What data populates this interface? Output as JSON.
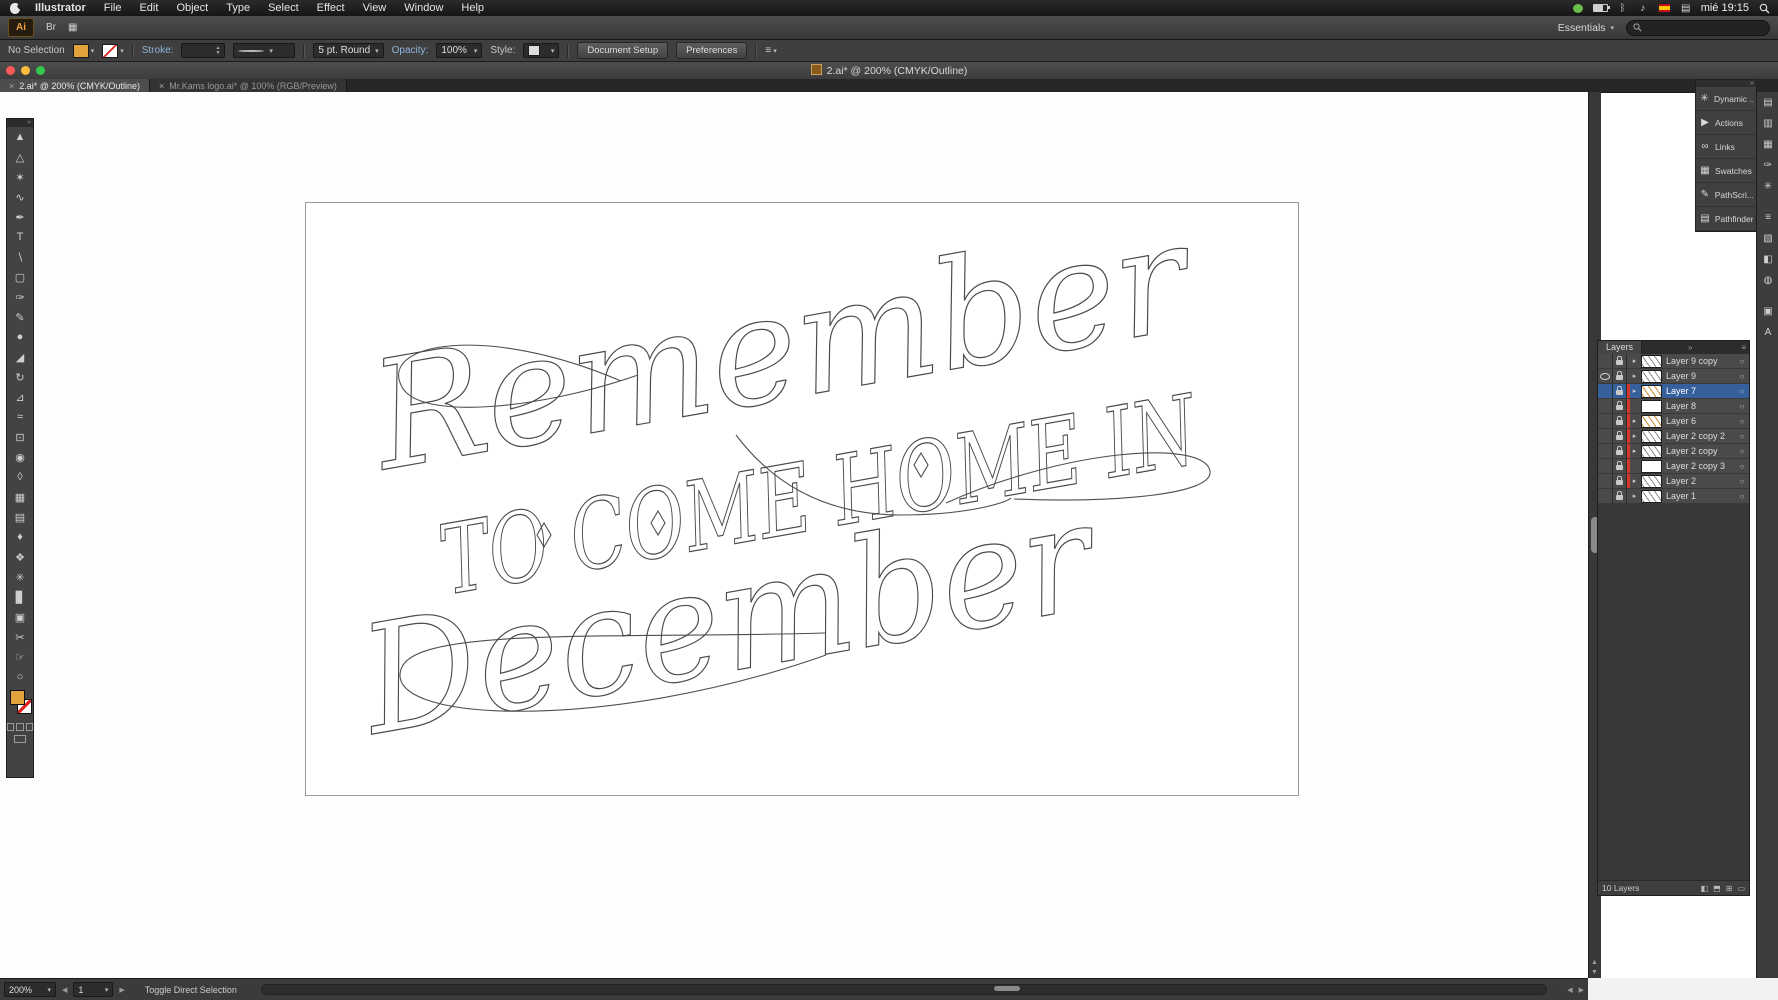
{
  "ui_colors": {
    "selection_blue": "#35609c",
    "fill_orange": "#e2a33d",
    "layer_color_red": "#d9372a",
    "artboard_outline": "#9a9a9a",
    "ui_dark": "#3f3f3f"
  },
  "icons": {
    "close": "×",
    "caret": "▾",
    "tri_right": "▸",
    "target_circle": "○",
    "collapse": "»",
    "panel_menu": "≡",
    "arrow_left": "◀",
    "arrow_right": "▶",
    "arrow_up": "▲",
    "arrow_down": "▼"
  },
  "menubar": {
    "app_name": "Illustrator",
    "menus": [
      "File",
      "Edit",
      "Object",
      "Type",
      "Select",
      "Effect",
      "View",
      "Window",
      "Help"
    ],
    "status_icons": [
      {
        "name": "green-app-icon",
        "kind": "green",
        "glyph": ""
      },
      {
        "name": "battery-icon",
        "kind": "battery",
        "glyph": ""
      },
      {
        "name": "bluetooth-icon",
        "kind": "glyph",
        "glyph": "ᛒ"
      },
      {
        "name": "volume-icon",
        "kind": "glyph",
        "glyph": "♪"
      },
      {
        "name": "keyboard-layout-flag-icon",
        "kind": "flag",
        "glyph": ""
      },
      {
        "name": "display-icon",
        "kind": "glyph",
        "glyph": "▤"
      }
    ],
    "clock": "mié 19:15"
  },
  "appbar": {
    "logo": "Ai",
    "icons": [
      {
        "name": "launch-bridge-icon",
        "glyph": "Br"
      },
      {
        "name": "arrange-documents-icon",
        "glyph": "▦"
      }
    ],
    "workspace": "Essentials",
    "search_value": ""
  },
  "controlbar": {
    "no_selection": "No Selection",
    "stroke_label": "Stroke:",
    "stroke_value": "",
    "brush_name": "5 pt. Round",
    "opacity_label": "Opacity:",
    "opacity_value": "100%",
    "style_label": "Style:",
    "buttons": {
      "document_setup": "Document Setup",
      "preferences": "Preferences"
    }
  },
  "window": {
    "title": "2.ai* @ 200% (CMYK/Outline)"
  },
  "tabs": [
    {
      "label": "2.ai* @ 200% (CMYK/Outline)",
      "active": true
    },
    {
      "label": "Mr.Kams logo.ai* @ 100% (RGB/Preview)",
      "active": false
    }
  ],
  "artwork": {
    "line1": "Remember",
    "line2": "TO COME HOME IN",
    "line3": "December"
  },
  "tools": [
    {
      "name": "selection-tool-icon",
      "glyph": "▲"
    },
    {
      "name": "direct-selection-tool-icon",
      "glyph": "△"
    },
    {
      "name": "magic-wand-tool-icon",
      "glyph": "✶"
    },
    {
      "name": "lasso-tool-icon",
      "glyph": "∿"
    },
    {
      "name": "pen-tool-icon",
      "glyph": "✒"
    },
    {
      "name": "type-tool-icon",
      "glyph": "T"
    },
    {
      "name": "line-segment-tool-icon",
      "glyph": "∖"
    },
    {
      "name": "rectangle-tool-icon",
      "glyph": "▢"
    },
    {
      "name": "paintbrush-tool-icon",
      "glyph": "✑"
    },
    {
      "name": "pencil-tool-icon",
      "glyph": "✎"
    },
    {
      "name": "blob-brush-tool-icon",
      "glyph": "●"
    },
    {
      "name": "eraser-tool-icon",
      "glyph": "◢"
    },
    {
      "name": "rotate-tool-icon",
      "glyph": "↻"
    },
    {
      "name": "scale-tool-icon",
      "glyph": "⊿"
    },
    {
      "name": "width-tool-icon",
      "glyph": "≈"
    },
    {
      "name": "free-transform-tool-icon",
      "glyph": "⊡"
    },
    {
      "name": "shape-builder-tool-icon",
      "glyph": "◉"
    },
    {
      "name": "perspective-grid-tool-icon",
      "glyph": "◊"
    },
    {
      "name": "mesh-tool-icon",
      "glyph": "▦"
    },
    {
      "name": "gradient-tool-icon",
      "glyph": "▤"
    },
    {
      "name": "eyedropper-tool-icon",
      "glyph": "♦"
    },
    {
      "name": "blend-tool-icon",
      "glyph": "❖"
    },
    {
      "name": "symbol-sprayer-tool-icon",
      "glyph": "✳"
    },
    {
      "name": "column-graph-tool-icon",
      "glyph": "▊"
    },
    {
      "name": "artboard-tool-icon",
      "glyph": "▣"
    },
    {
      "name": "slice-tool-icon",
      "glyph": "✂"
    },
    {
      "name": "hand-tool-icon",
      "glyph": "☞"
    },
    {
      "name": "zoom-tool-icon",
      "glyph": "○"
    }
  ],
  "dock_panels": [
    {
      "name": "dock-panel-dynamic",
      "glyph": "✳",
      "label": "Dynamic ..."
    },
    {
      "name": "dock-panel-actions",
      "glyph": "▶",
      "label": "Actions"
    },
    {
      "name": "dock-panel-links",
      "glyph": "∞",
      "label": "Links"
    },
    {
      "name": "dock-panel-swatches",
      "glyph": "▦",
      "label": "Swatches"
    },
    {
      "name": "dock-panel-pathscribe",
      "glyph": "✎",
      "label": "PathScri..."
    },
    {
      "name": "dock-panel-pathfinder",
      "glyph": "▤",
      "label": "Pathfinder"
    }
  ],
  "right_strip": [
    {
      "name": "color-panel-icon",
      "glyph": "▤",
      "gap": false
    },
    {
      "name": "color-guide-panel-icon",
      "glyph": "▥",
      "gap": false
    },
    {
      "name": "swatches-panel-icon",
      "glyph": "▦",
      "gap": false
    },
    {
      "name": "brushes-panel-icon",
      "glyph": "✑",
      "gap": false
    },
    {
      "name": "symbols-panel-icon",
      "glyph": "✳",
      "gap": false
    },
    {
      "name": "stroke-panel-icon",
      "glyph": "≡",
      "gap": true
    },
    {
      "name": "gradient-panel-icon",
      "glyph": "▧",
      "gap": false
    },
    {
      "name": "transparency-panel-icon",
      "glyph": "◧",
      "gap": false
    },
    {
      "name": "appearance-panel-icon",
      "glyph": "◍",
      "gap": false
    },
    {
      "name": "graphic-styles-panel-icon",
      "glyph": "▣",
      "gap": true
    },
    {
      "name": "character-panel-icon",
      "glyph": "A",
      "gap": false
    }
  ],
  "layers_panel": {
    "title": "Layers",
    "layers": [
      {
        "name": "Layer 9 copy",
        "selected": false,
        "eye": false,
        "red": false,
        "tri": true,
        "thumb": "art"
      },
      {
        "name": "Layer 9",
        "selected": false,
        "eye": true,
        "red": false,
        "tri": true,
        "thumb": "art"
      },
      {
        "name": "Layer 7",
        "selected": true,
        "eye": false,
        "red": true,
        "tri": true,
        "thumb": "orange"
      },
      {
        "name": "Layer 8",
        "selected": false,
        "eye": false,
        "red": true,
        "tri": false,
        "thumb": "blank"
      },
      {
        "name": "Layer 6",
        "selected": false,
        "eye": false,
        "red": true,
        "tri": true,
        "thumb": "orange"
      },
      {
        "name": "Layer 2 copy 2",
        "selected": false,
        "eye": false,
        "red": true,
        "tri": true,
        "thumb": "art"
      },
      {
        "name": "Layer 2 copy",
        "selected": false,
        "eye": false,
        "red": true,
        "tri": true,
        "thumb": "art"
      },
      {
        "name": "Layer 2 copy 3",
        "selected": false,
        "eye": false,
        "red": true,
        "tri": false,
        "thumb": "blank"
      },
      {
        "name": "Layer 2",
        "selected": false,
        "eye": false,
        "red": true,
        "tri": true,
        "thumb": "art"
      },
      {
        "name": "Layer 1",
        "selected": false,
        "eye": false,
        "red": false,
        "tri": true,
        "thumb": "art"
      }
    ],
    "status": "10 Layers",
    "footer_icons": [
      {
        "name": "make-clipping-mask-icon",
        "glyph": "◧"
      },
      {
        "name": "new-sublayer-icon",
        "glyph": "⬒"
      },
      {
        "name": "new-layer-icon",
        "glyph": "⊞"
      },
      {
        "name": "delete-layer-icon",
        "glyph": "▭"
      }
    ]
  },
  "bottombar": {
    "zoom": "200%",
    "artboard_number": "1",
    "hint": "Toggle Direct Selection"
  }
}
